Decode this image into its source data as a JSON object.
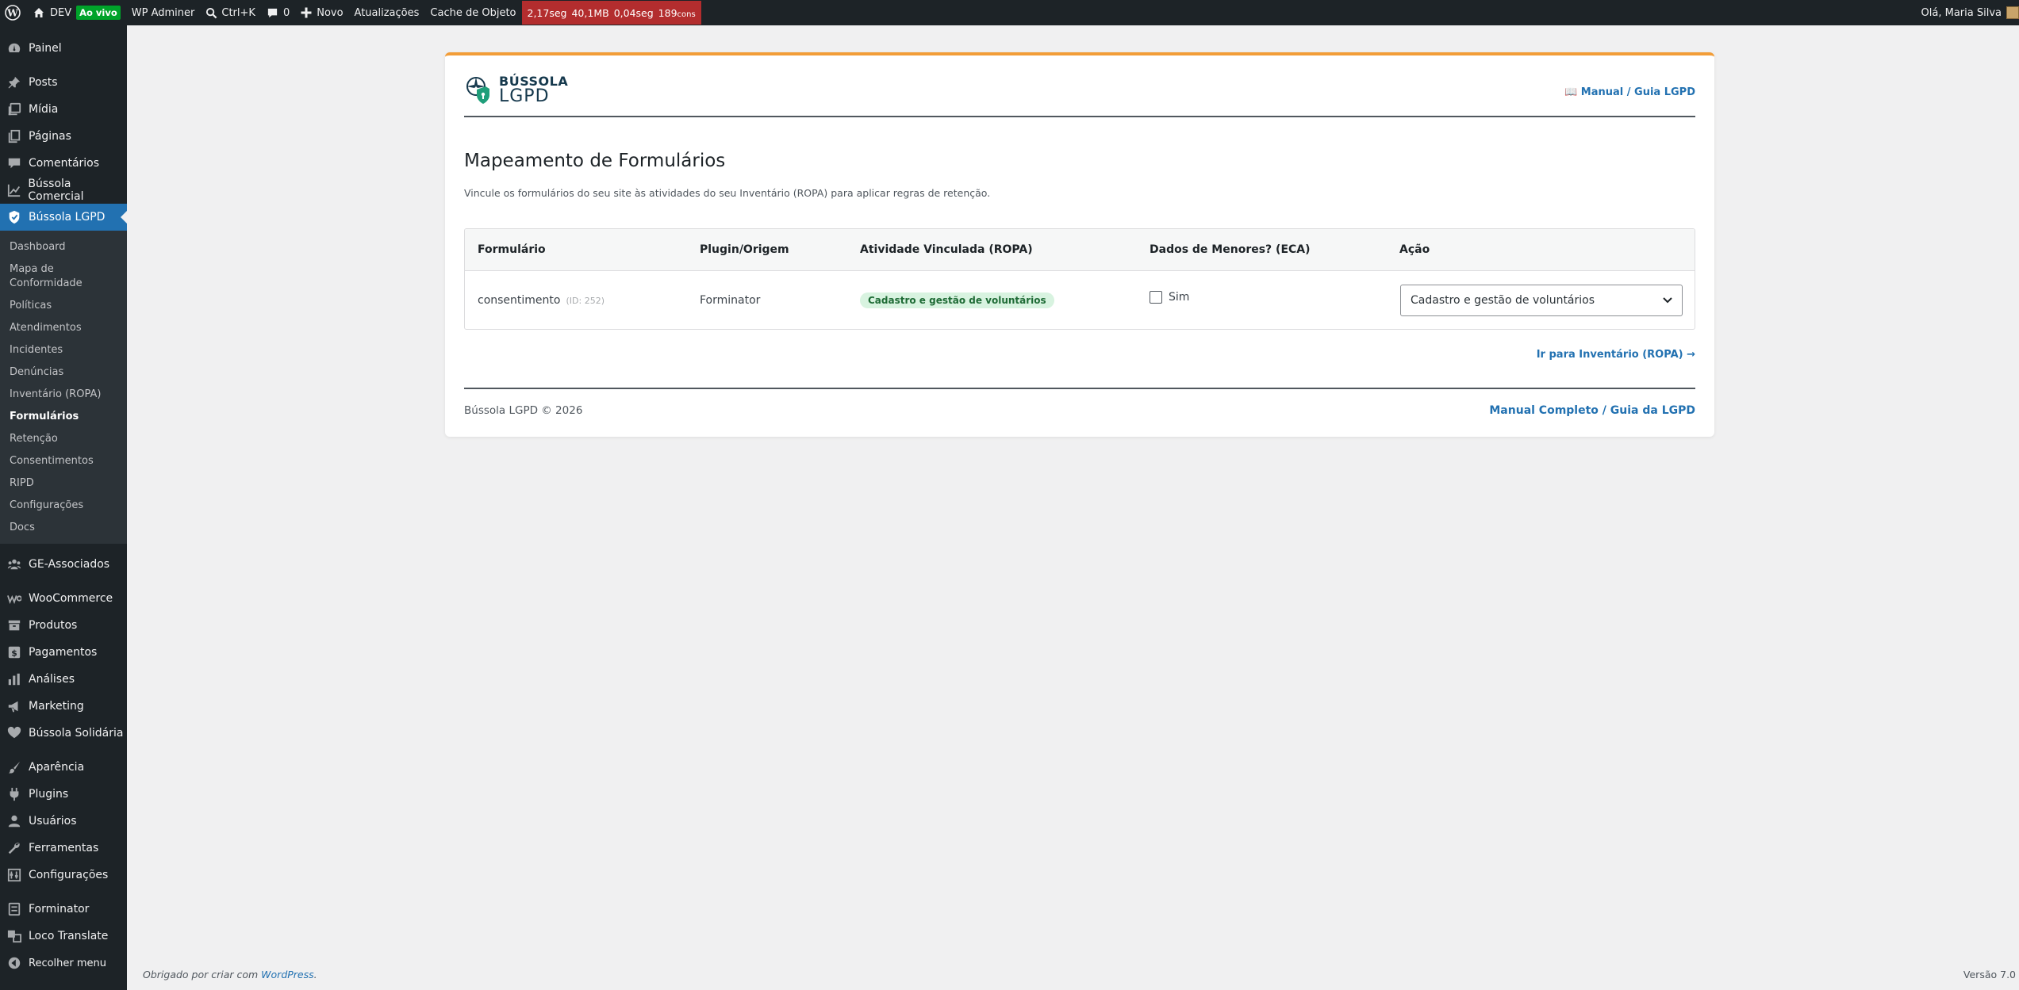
{
  "adminbar": {
    "site_name": "DEV",
    "live_badge": "Ao vivo",
    "adminer": "WP Adminer",
    "search_shortcut": "Ctrl+K",
    "comments_count": "0",
    "new_label": "Novo",
    "updates_label": "Atualizações",
    "cache_label": "Cache de Objeto",
    "qm_time": "2,17seg",
    "qm_memory": "40,1MB",
    "qm_db_time": "0,04seg",
    "qm_queries": "189",
    "qm_queries_unit": "cons",
    "greeting": "Olá, Maria Silva"
  },
  "sidebar": {
    "items_top": [
      {
        "label": "Painel",
        "icon": "dashboard-icon"
      }
    ],
    "items_content": [
      {
        "label": "Posts",
        "icon": "pin-icon"
      },
      {
        "label": "Mídia",
        "icon": "media-icon"
      },
      {
        "label": "Páginas",
        "icon": "pages-icon"
      },
      {
        "label": "Comentários",
        "icon": "comment-icon"
      },
      {
        "label": "Bússola Comercial",
        "icon": "chart-line-icon"
      }
    ],
    "current": {
      "label": "Bússola LGPD",
      "icon": "shield-icon"
    },
    "submenu": [
      "Dashboard",
      "Mapa de Conformidade",
      "Políticas",
      "Atendimentos",
      "Incidentes",
      "Denúncias",
      "Inventário (ROPA)",
      "Formulários",
      "Retenção",
      "Consentimentos",
      "RIPD",
      "Configurações",
      "Docs"
    ],
    "submenu_active_index": 7,
    "items_ge": [
      {
        "label": "GE-Associados",
        "icon": "groups-icon"
      }
    ],
    "items_commerce": [
      {
        "label": "WooCommerce",
        "icon": "woo-icon"
      },
      {
        "label": "Produtos",
        "icon": "archive-icon"
      },
      {
        "label": "Pagamentos",
        "icon": "money-icon"
      },
      {
        "label": "Análises",
        "icon": "bar-chart-icon"
      },
      {
        "label": "Marketing",
        "icon": "megaphone-icon"
      },
      {
        "label": "Bússola Solidária",
        "icon": "heart-icon"
      }
    ],
    "items_admin": [
      {
        "label": "Aparência",
        "icon": "brush-icon"
      },
      {
        "label": "Plugins",
        "icon": "plug-icon"
      },
      {
        "label": "Usuários",
        "icon": "user-icon"
      },
      {
        "label": "Ferramentas",
        "icon": "wrench-icon"
      },
      {
        "label": "Configurações",
        "icon": "settings-icon"
      }
    ],
    "items_extra": [
      {
        "label": "Forminator",
        "icon": "form-icon"
      },
      {
        "label": "Loco Translate",
        "icon": "translate-icon"
      },
      {
        "label": "Recolher menu",
        "icon": "collapse-icon"
      }
    ]
  },
  "card": {
    "logo_line1": "BÚSSOLA",
    "logo_line2": "LGPD",
    "manual_link": "📖 Manual / Guia LGPD",
    "title": "Mapeamento de Formulários",
    "description": "Vincule os formulários do seu site às atividades do seu Inventário (ROPA) para aplicar regras de retenção.",
    "table": {
      "headers": [
        "Formulário",
        "Plugin/Origem",
        "Atividade Vinculada (ROPA)",
        "Dados de Menores? (ECA)",
        "Ação"
      ],
      "rows": [
        {
          "form": "consentimento",
          "id_note": "(ID: 252)",
          "origin": "Forminator",
          "activity": "Cadastro e gestão de voluntários",
          "minors_label": "Sim",
          "minors_checked": false,
          "action_selected": "Cadastro e gestão de voluntários"
        }
      ]
    },
    "ropa_link": "Ir para Inventário (ROPA) →",
    "footer_copy": "Bússola LGPD © 2026",
    "footer_link": "Manual Completo / Guia da LGPD"
  },
  "wpfooter": {
    "thanks": "Obrigado por criar com",
    "wp_link": "WordPress",
    "version": "Versão 7.0"
  }
}
